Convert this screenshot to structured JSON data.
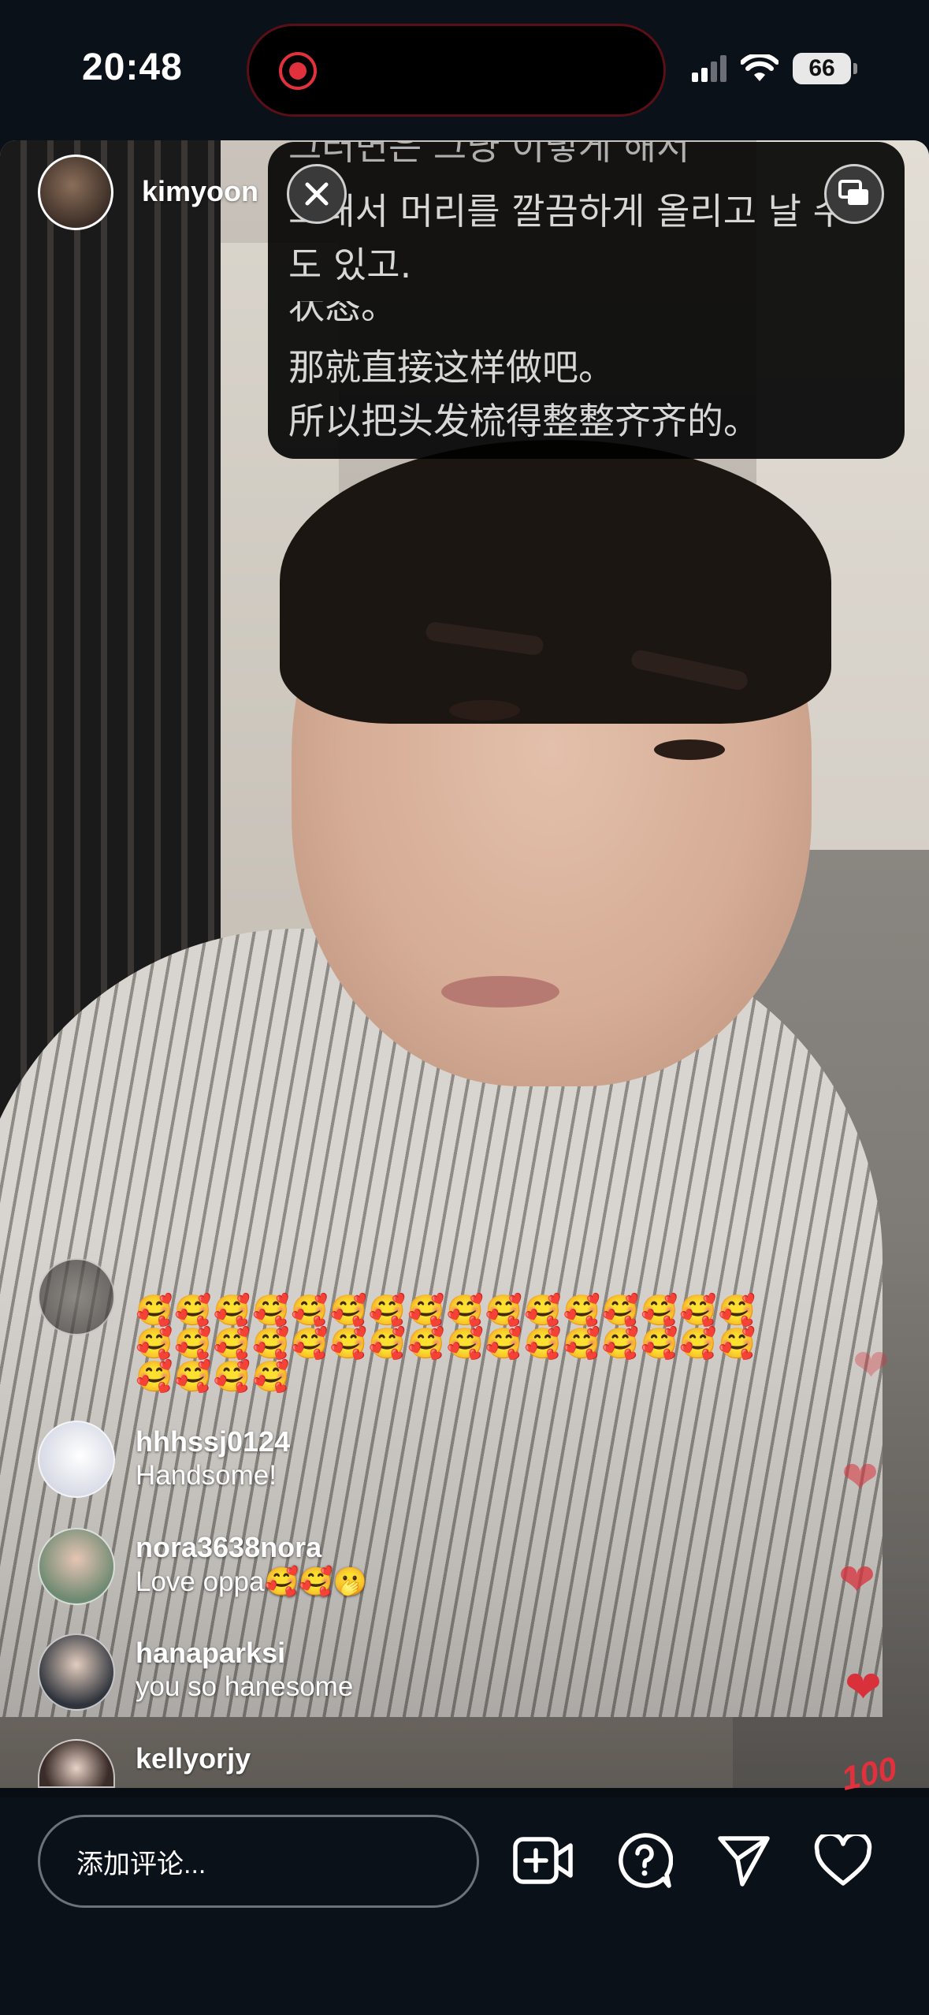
{
  "status_bar": {
    "time": "20:48",
    "battery": "66"
  },
  "host": {
    "username": "kimyoon"
  },
  "captions": {
    "lines": [
      "그래서 머리를 깔끔하게 올리고 날 수",
      "도 있고.",
      "那就直接这样做吧。",
      "所以把头发梳得整整齐齐的。"
    ],
    "partial_top": "그러면은 그냥 이렇게 해서",
    "partial_mid": "状态。"
  },
  "comments": [
    {
      "username": "",
      "emojis": [
        "🥰🥰🥰🥰🥰🥰🥰🥰🥰🥰🥰🥰🥰🥰🥰🥰",
        "🥰🥰🥰🥰🥰🥰🥰🥰🥰🥰🥰🥰🥰🥰🥰🥰",
        "🥰🥰🥰🥰"
      ]
    },
    {
      "username": "hhhssj0124",
      "text": "Handsome!"
    },
    {
      "username": "nora3638nora",
      "text": "Love oppa🥰🥰🫢"
    },
    {
      "username": "hanaparksi",
      "text": "you so hanesome"
    },
    {
      "username": "kellyorjy",
      "text": ""
    }
  ],
  "bottom_bar": {
    "comment_placeholder": "添加评论..."
  },
  "reactions": {
    "hundred": "100"
  },
  "colors": {
    "accent_red": "#e0313c",
    "background": "#0b1119"
  }
}
